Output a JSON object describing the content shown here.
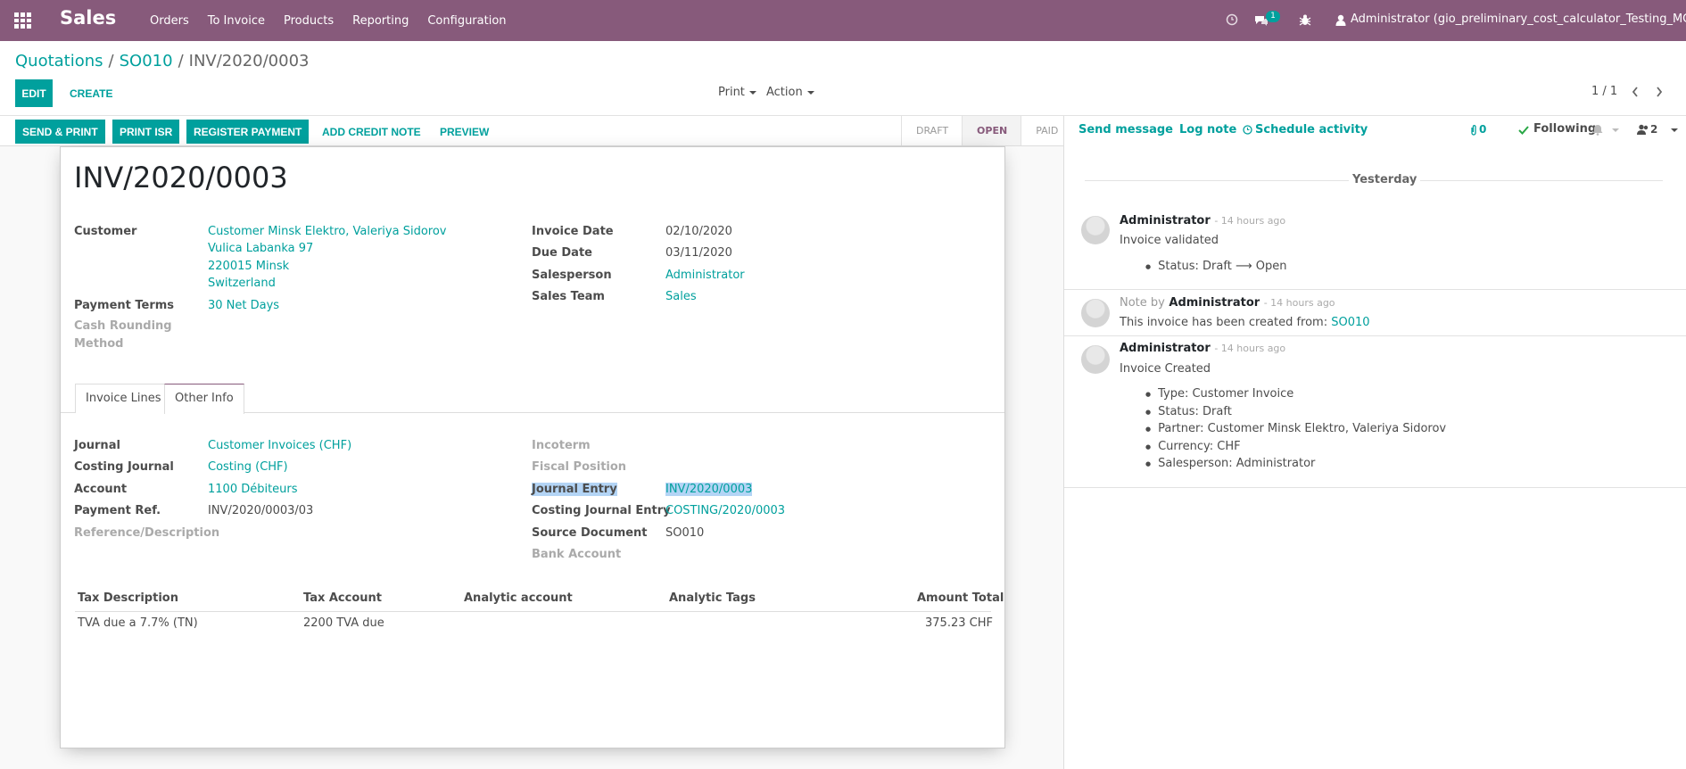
{
  "navbar": {
    "brand": "Sales",
    "menu": [
      "Orders",
      "To Invoice",
      "Products",
      "Reporting",
      "Configuration"
    ],
    "messages_badge": "1",
    "user": "Administrator (gio_preliminary_cost_calculator_Testing_MG)"
  },
  "breadcrumb": {
    "root": "Quotations",
    "parent": "SO010",
    "current": "INV/2020/0003"
  },
  "control": {
    "edit": "EDIT",
    "create": "CREATE",
    "print": "Print",
    "action": "Action",
    "pager": "1 / 1"
  },
  "statusbar": {
    "buttons": [
      "SEND & PRINT",
      "PRINT ISR",
      "REGISTER PAYMENT",
      "ADD CREDIT NOTE",
      "PREVIEW"
    ],
    "stages": [
      "DRAFT",
      "OPEN",
      "PAID"
    ],
    "active_stage": "OPEN"
  },
  "invoice": {
    "title": "INV/2020/0003",
    "customer_label": "Customer",
    "customer_lines": [
      "Customer Minsk Elektro, Valeriya Sidorov",
      "Vulica Labanka 97",
      "220015 Minsk",
      "Switzerland"
    ],
    "payment_terms_label": "Payment Terms",
    "payment_terms": "30 Net Days",
    "cash_rounding_label_1": "Cash Rounding",
    "cash_rounding_label_2": "Method",
    "invoice_date_label": "Invoice Date",
    "invoice_date": "02/10/2020",
    "due_date_label": "Due Date",
    "due_date": "03/11/2020",
    "salesperson_label": "Salesperson",
    "salesperson": "Administrator",
    "sales_team_label": "Sales Team",
    "sales_team": "Sales"
  },
  "tabs": [
    "Invoice Lines",
    "Other Info"
  ],
  "other_info": {
    "journal_label": "Journal",
    "journal": "Customer Invoices (CHF)",
    "costing_journal_label": "Costing Journal",
    "costing_journal": "Costing (CHF)",
    "account_label": "Account",
    "account": "1100 Débiteurs",
    "payment_ref_label": "Payment Ref.",
    "payment_ref": "INV/2020/0003/03",
    "reference_label": "Reference/Description",
    "incoterm_label": "Incoterm",
    "fiscal_position_label": "Fiscal Position",
    "journal_entry_label": "Journal Entry",
    "journal_entry": "INV/2020/0003",
    "costing_journal_entry_label": "Costing Journal Entry",
    "costing_journal_entry": "COSTING/2020/0003",
    "source_document_label": "Source Document",
    "source_document": "SO010",
    "bank_account_label": "Bank Account"
  },
  "tax_table": {
    "headers": [
      "Tax Description",
      "Tax Account",
      "Analytic account",
      "Analytic Tags",
      "Amount Total"
    ],
    "rows": [
      [
        "TVA due a 7.7% (TN)",
        "2200 TVA due",
        "",
        "",
        "375.23 CHF"
      ]
    ]
  },
  "chatter": {
    "send_message": "Send message",
    "log_note": "Log note",
    "schedule_activity": "Schedule activity",
    "attachments": "0",
    "following": "Following",
    "followers": "2",
    "date_separator": "Yesterday",
    "messages": [
      {
        "author": "Administrator",
        "time": "- 14 hours ago",
        "body": "Invoice validated",
        "bullets": [
          "Status: Draft ⟶ Open"
        ]
      },
      {
        "prefix": "Note by",
        "author": "Administrator",
        "time": "- 14 hours ago",
        "body": "This invoice has been created from:",
        "link": "SO010"
      },
      {
        "author": "Administrator",
        "time": "- 14 hours ago",
        "body": "Invoice Created",
        "bullets": [
          "Type: Customer Invoice",
          "Status: Draft",
          "Partner: Customer Minsk Elektro, Valeriya Sidorov",
          "Currency: CHF",
          "Salesperson: Administrator"
        ]
      }
    ]
  }
}
